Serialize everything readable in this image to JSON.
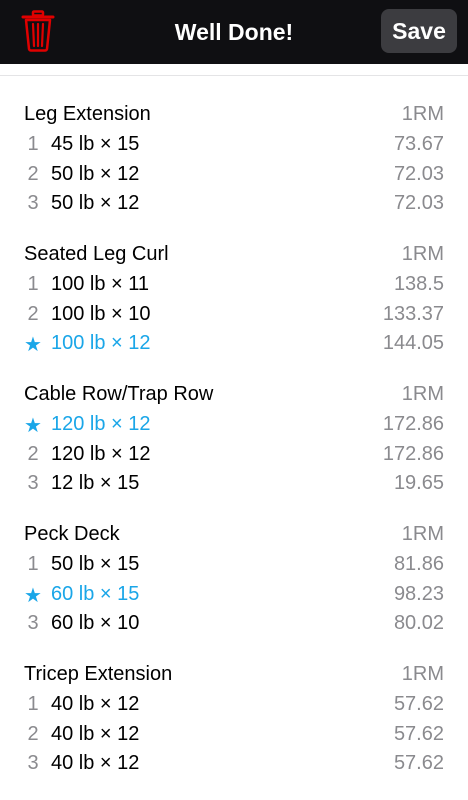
{
  "header": {
    "title": "Well Done!",
    "save_label": "Save",
    "delete_icon": "trash-icon",
    "accent_delete": "#e00000"
  },
  "colors": {
    "bar_bg": "#0f0f12",
    "best_set": "#1aa6e8",
    "muted": "#8a8a8e"
  },
  "exercises": [
    {
      "name": "Leg Extension",
      "column": "1RM",
      "sets": [
        {
          "marker": "1",
          "text": "45 lb × 15",
          "value": "73.67",
          "best": false
        },
        {
          "marker": "2",
          "text": "50 lb × 12",
          "value": "72.03",
          "best": false
        },
        {
          "marker": "3",
          "text": "50 lb × 12",
          "value": "72.03",
          "best": false
        }
      ]
    },
    {
      "name": "Seated Leg Curl",
      "column": "1RM",
      "sets": [
        {
          "marker": "1",
          "text": "100 lb × 11",
          "value": "138.5",
          "best": false
        },
        {
          "marker": "2",
          "text": "100 lb × 10",
          "value": "133.37",
          "best": false
        },
        {
          "marker": "★",
          "text": "100 lb × 12",
          "value": "144.05",
          "best": true
        }
      ]
    },
    {
      "name": "Cable Row/Trap Row",
      "column": "1RM",
      "sets": [
        {
          "marker": "★",
          "text": "120 lb × 12",
          "value": "172.86",
          "best": true
        },
        {
          "marker": "2",
          "text": "120 lb × 12",
          "value": "172.86",
          "best": false
        },
        {
          "marker": "3",
          "text": "12 lb × 15",
          "value": "19.65",
          "best": false
        }
      ]
    },
    {
      "name": "Peck Deck",
      "column": "1RM",
      "sets": [
        {
          "marker": "1",
          "text": "50 lb × 15",
          "value": "81.86",
          "best": false
        },
        {
          "marker": "★",
          "text": "60 lb × 15",
          "value": "98.23",
          "best": true
        },
        {
          "marker": "3",
          "text": "60 lb × 10",
          "value": "80.02",
          "best": false
        }
      ]
    },
    {
      "name": "Tricep Extension",
      "column": "1RM",
      "sets": [
        {
          "marker": "1",
          "text": "40 lb × 12",
          "value": "57.62",
          "best": false
        },
        {
          "marker": "2",
          "text": "40 lb × 12",
          "value": "57.62",
          "best": false
        },
        {
          "marker": "3",
          "text": "40 lb × 12",
          "value": "57.62",
          "best": false
        }
      ]
    }
  ]
}
